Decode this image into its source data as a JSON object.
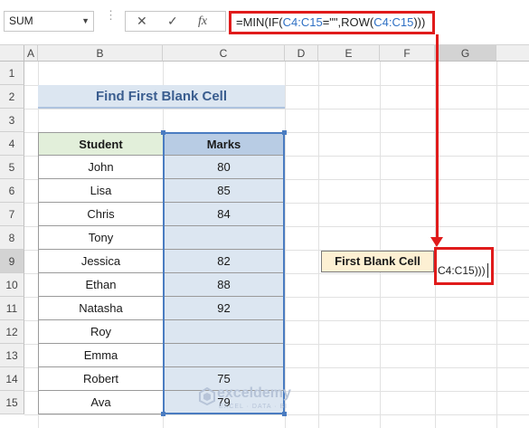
{
  "namebox": {
    "value": "SUM"
  },
  "toolbar": {
    "cancel_glyph": "✕",
    "enter_glyph": "✓",
    "fx_label": "fx"
  },
  "formula_bar": {
    "part1": "=MIN(IF(",
    "ref1": "C4:C15",
    "part2": "=\"\",ROW(",
    "ref2": "C4:C15",
    "part3": ")))"
  },
  "columns": [
    "A",
    "B",
    "C",
    "D",
    "E",
    "F",
    "G"
  ],
  "rows": [
    "1",
    "2",
    "3",
    "4",
    "5",
    "6",
    "7",
    "8",
    "9",
    "10",
    "11",
    "12",
    "13",
    "14",
    "15"
  ],
  "title": "Find First Blank Cell",
  "table": {
    "headers": {
      "student": "Student",
      "marks": "Marks"
    },
    "students": [
      "John",
      "Lisa",
      "Chris",
      "Tony",
      "Jessica",
      "Ethan",
      "Natasha",
      "Roy",
      "Emma",
      "Robert",
      "Ava"
    ],
    "marks": [
      "80",
      "85",
      "84",
      "",
      "82",
      "88",
      "92",
      "",
      "",
      "75",
      "79"
    ]
  },
  "result": {
    "label": "First Blank  Cell",
    "edit_line1": "",
    "edit_line2": "C4:C15)))"
  },
  "watermark": {
    "brand": "exceldemy",
    "tagline": "EXCEL · DATA · BI"
  },
  "colors": {
    "accent_red": "#e01b1b",
    "selection_blue": "#4a7cc1",
    "header_green": "#e2efda",
    "header_blue": "#b8cce4"
  },
  "icons": [
    "dropdown-arrow-icon",
    "cancel-icon",
    "enter-check-icon",
    "function-icon",
    "exceldemy-logo-icon"
  ]
}
